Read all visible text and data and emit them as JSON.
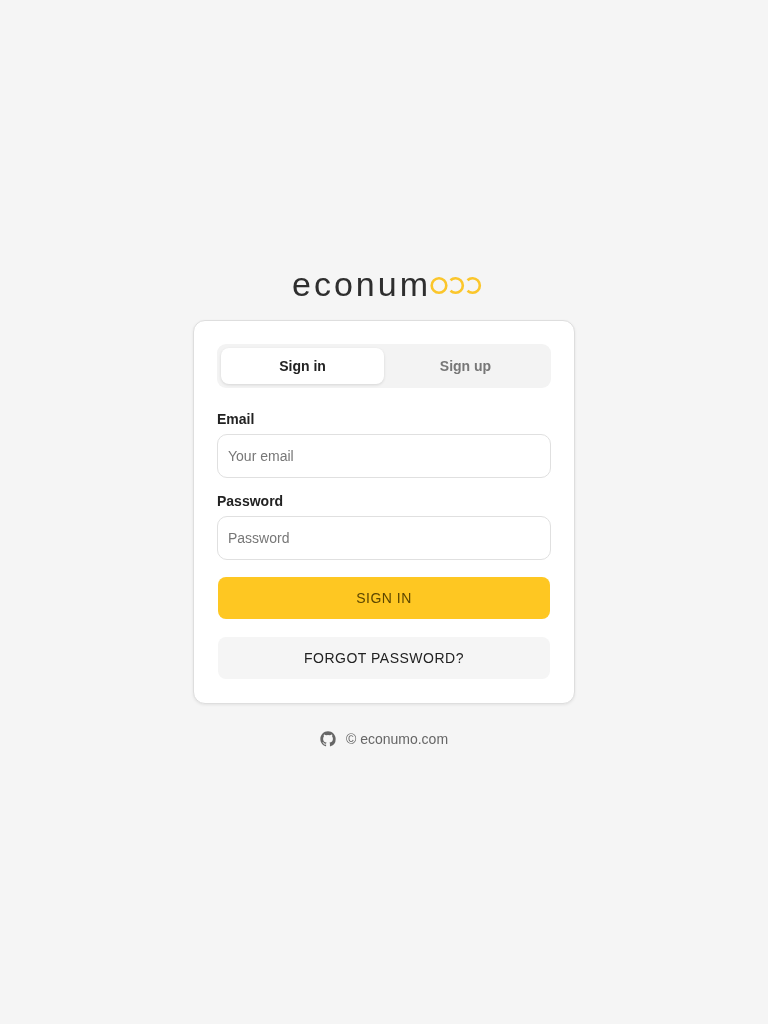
{
  "logo": {
    "text": "econum"
  },
  "tabs": [
    {
      "label": "Sign in",
      "selected": true
    },
    {
      "label": "Sign up",
      "selected": false
    }
  ],
  "fields": [
    {
      "label": "Email",
      "placeholder": "Your email"
    },
    {
      "label": "Password",
      "placeholder": "Password"
    }
  ],
  "buttons": [
    {
      "label": "SIGN IN",
      "kind": "primary"
    },
    {
      "label": "FORGOT PASSWORD?",
      "kind": "secondary"
    }
  ],
  "footer": {
    "text": "© econumo.com"
  }
}
